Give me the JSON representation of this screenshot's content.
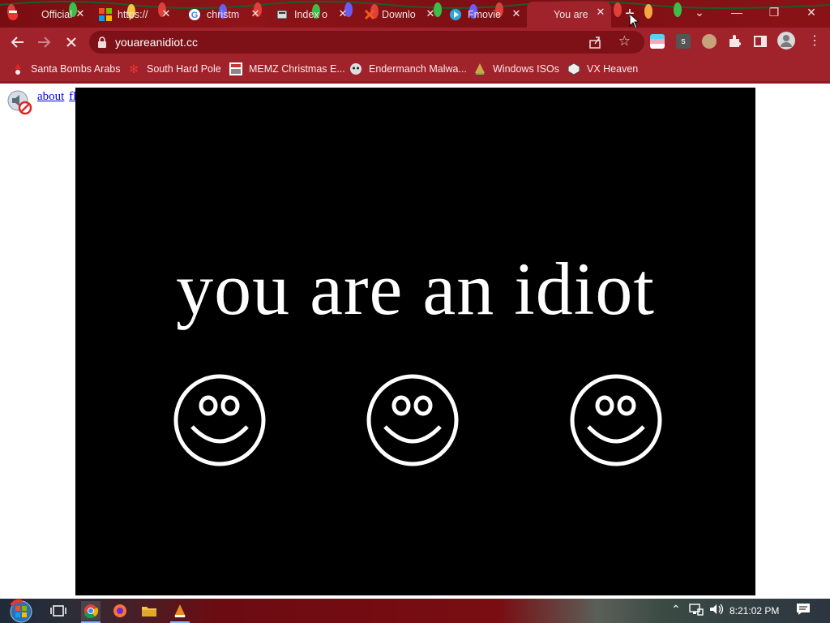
{
  "browser": {
    "tabs": [
      {
        "title": "Official",
        "favicon": "santa-icon"
      },
      {
        "title": "https://",
        "favicon": "microsoft-icon"
      },
      {
        "title": "christm",
        "favicon": "google-icon"
      },
      {
        "title": "Index o",
        "favicon": "index-icon"
      },
      {
        "title": "Downlo",
        "favicon": "download-x-icon"
      },
      {
        "title": "Fmovie",
        "favicon": "play-icon"
      },
      {
        "title": "You are",
        "favicon": "page-icon",
        "active": true
      }
    ],
    "url": "youareanidiot.cc",
    "bookmarks": [
      {
        "label": "Santa Bombs Arabs",
        "icon": "santa-icon"
      },
      {
        "label": "South Hard Pole",
        "icon": "snowflake-icon"
      },
      {
        "label": "MEMZ Christmas E...",
        "icon": "memz-icon"
      },
      {
        "label": "Endermanch Malwa...",
        "icon": "endermanch-icon"
      },
      {
        "label": "Windows ISOs",
        "icon": "windows-iso-icon"
      },
      {
        "label": "VX Heaven",
        "icon": "vx-heaven-icon"
      }
    ]
  },
  "page": {
    "links": [
      "about",
      "flash"
    ],
    "headline": "you are an idiot",
    "smiley_count": 3
  },
  "taskbar": {
    "time": "8:21:02 PM"
  },
  "colors": {
    "titlebar": "#7a0d12",
    "toolbar": "#a0222b",
    "stage": "#000000",
    "stage_text": "#ffffff"
  }
}
